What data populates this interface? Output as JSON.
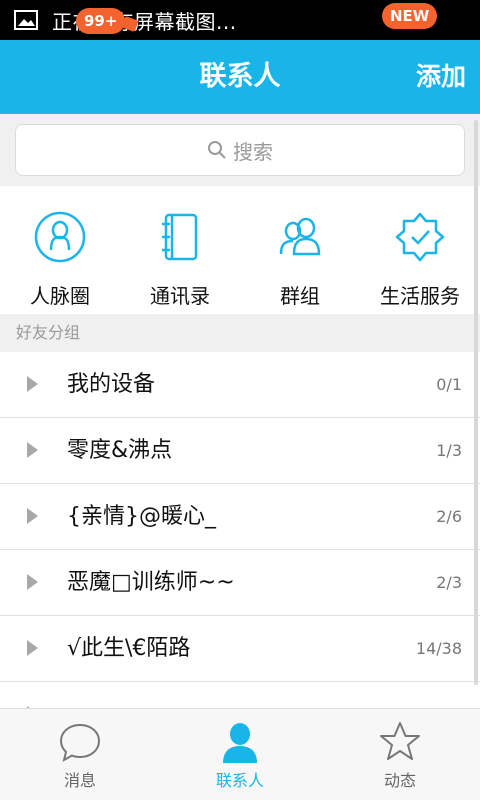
{
  "status_bar": {
    "text": "正在保存屏幕截图..."
  },
  "header": {
    "title": "联系人",
    "add_label": "添加"
  },
  "search": {
    "placeholder": "搜索"
  },
  "features": [
    {
      "label": "人脉圈",
      "icon": "person-circle-icon"
    },
    {
      "label": "通讯录",
      "icon": "address-book-icon"
    },
    {
      "label": "群组",
      "icon": "group-icon"
    },
    {
      "label": "生活服务",
      "icon": "badge-check-icon"
    }
  ],
  "section": {
    "label": "好友分组"
  },
  "groups": [
    {
      "name": "我的设备",
      "count": "0/1"
    },
    {
      "name": "零度&沸点",
      "count": "1/3"
    },
    {
      "name": "{亲情}@暖心_",
      "count": "2/6"
    },
    {
      "name": "恶魔□训练师~~",
      "count": "2/3"
    },
    {
      "name": " √此生\\€陌路",
      "count": "14/38"
    },
    {
      "name": "",
      "count": ""
    }
  ],
  "tabs": [
    {
      "label": "消息",
      "badge": "99+",
      "active": false
    },
    {
      "label": "联系人",
      "badge": "",
      "active": true
    },
    {
      "label": "动态",
      "badge": "NEW",
      "active": false
    }
  ],
  "colors": {
    "accent": "#19b5e8",
    "badge": "#f4622e",
    "header_text": "#ffffff"
  }
}
